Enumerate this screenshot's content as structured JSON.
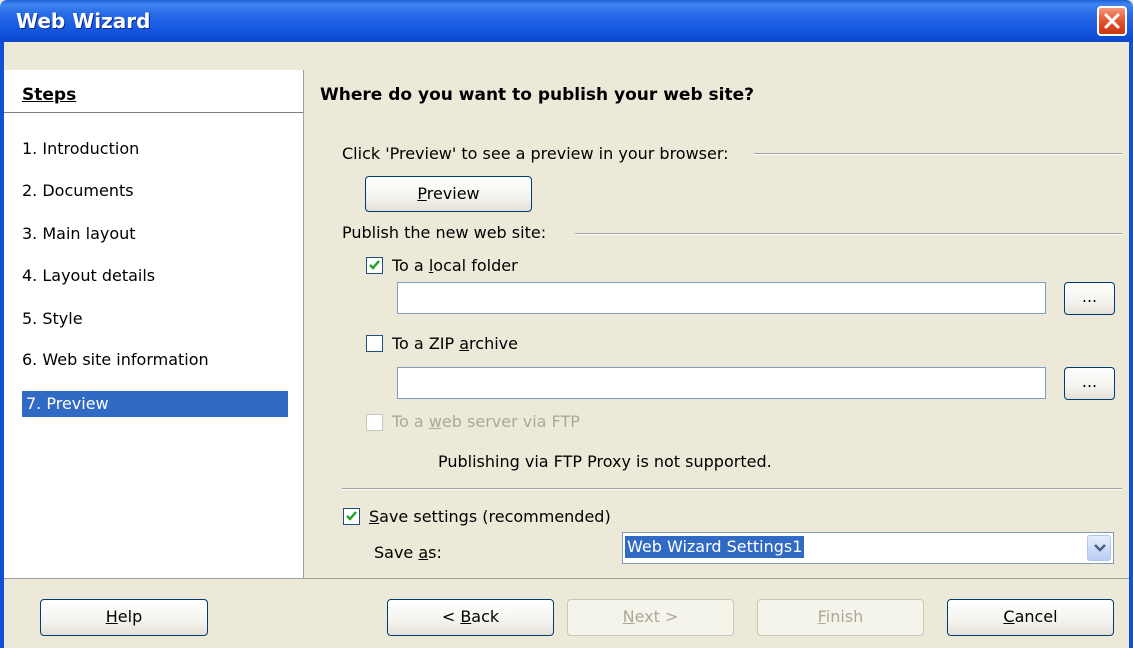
{
  "window": {
    "title": "Web Wizard"
  },
  "steps": {
    "title": "Steps",
    "items": [
      {
        "label": "1.  Introduction"
      },
      {
        "label": "2.  Documents"
      },
      {
        "label": "3.  Main layout"
      },
      {
        "label": "4.  Layout details"
      },
      {
        "label": "5.  Style"
      },
      {
        "label": "6.  Web site information"
      },
      {
        "label": "7.  Preview"
      }
    ],
    "active_index": 6
  },
  "main": {
    "heading": "Where do you want to publish your web site?",
    "preview_section_label": "Click 'Preview' to see a preview in your browser:",
    "preview_button": {
      "label": "Preview",
      "accel": "P",
      "rest": "review"
    },
    "publish_section_label": "Publish the new web site:",
    "local_folder": {
      "checked": true,
      "label_pre": "To a ",
      "accel": "l",
      "label_post": "ocal folder",
      "path": ""
    },
    "zip_archive": {
      "checked": false,
      "label_pre": "To a ZIP ",
      "accel": "a",
      "label_post": "rchive",
      "path": ""
    },
    "browse_label": "...",
    "ftp": {
      "checked": false,
      "disabled": true,
      "label_pre": "To a ",
      "accel": "w",
      "label_post": "eb server via FTP"
    },
    "ftp_note": "Publishing via FTP Proxy is not supported.",
    "save_settings": {
      "checked": true,
      "accel": "S",
      "label_post": "ave settings (recommended)"
    },
    "save_as": {
      "label_pre": "Save ",
      "accel": "a",
      "label_post": "s:",
      "value": "Web Wizard Settings1"
    }
  },
  "buttons": {
    "help": {
      "accel": "H",
      "rest": "elp"
    },
    "back": {
      "pre": "< ",
      "accel": "B",
      "rest": "ack"
    },
    "next": {
      "accel": "N",
      "rest": "ext >"
    },
    "finish": {
      "accel": "F",
      "rest": "inish"
    },
    "cancel": {
      "accel": "C",
      "rest": "ancel"
    }
  },
  "colors": {
    "titlebar": "#2b6ee8",
    "selection": "#316ac5",
    "dialog_bg": "#ece9d8"
  }
}
